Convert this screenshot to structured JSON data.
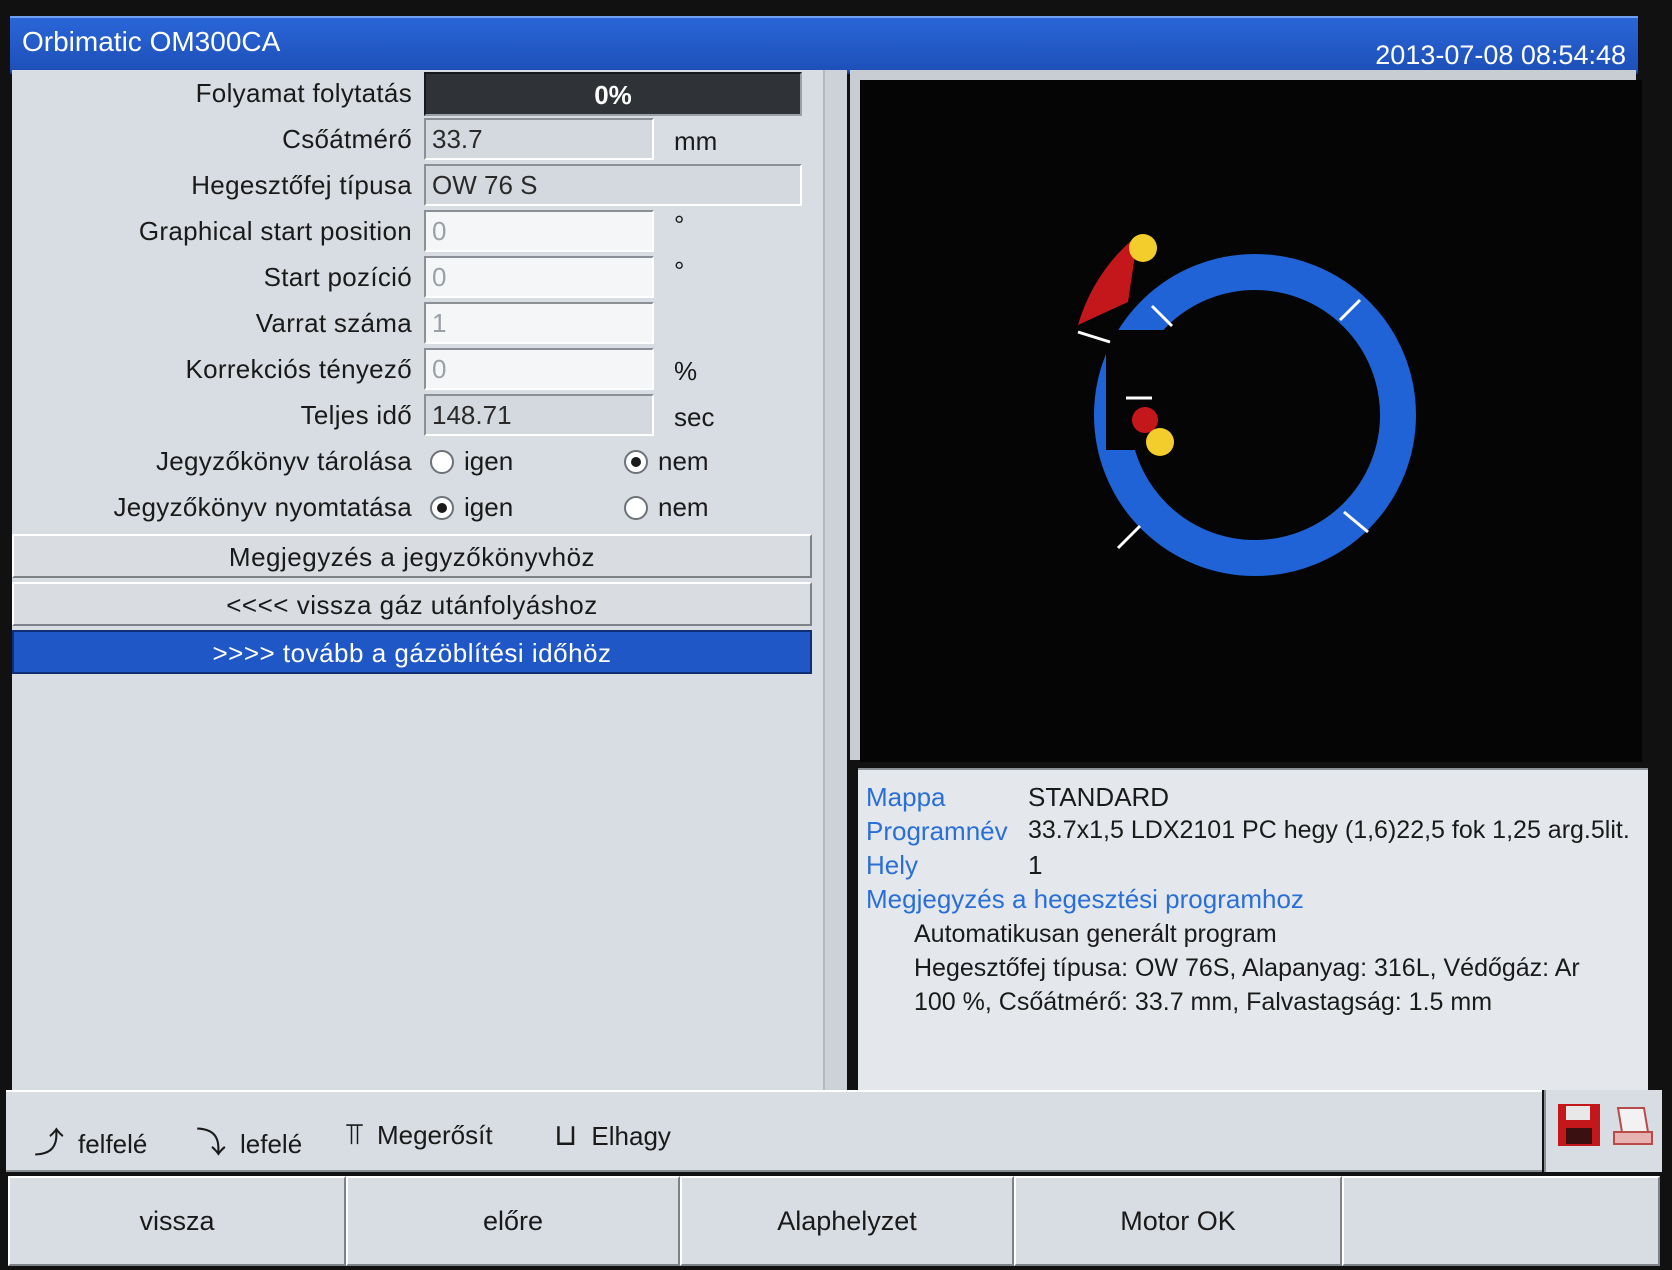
{
  "window": {
    "title": "Orbimatic OM300CA",
    "datetime": "2013-07-08 08:54:48"
  },
  "form": {
    "progress": {
      "label": "Folyamat folytatás",
      "value": "0%"
    },
    "tube_diameter": {
      "label": "Csőátmérő",
      "value": "33.7",
      "unit": "mm"
    },
    "head_type": {
      "label": "Hegesztőfej típusa",
      "value": "OW 76 S"
    },
    "graphical_start": {
      "label": "Graphical start position",
      "value": "0",
      "unit": "°"
    },
    "start_position": {
      "label": "Start pozíció",
      "value": "0",
      "unit": "°"
    },
    "seam_number": {
      "label": "Varrat száma",
      "value": "1"
    },
    "correction": {
      "label": "Korrekciós tényező",
      "value": "0",
      "unit": "%"
    },
    "total_time": {
      "label": "Teljes idő",
      "value": "148.71",
      "unit": "sec"
    },
    "store_protocol": {
      "label": "Jegyzőkönyv tárolása",
      "yes": "igen",
      "no": "nem",
      "selected": "nem"
    },
    "print_protocol": {
      "label": "Jegyzőkönyv nyomtatása",
      "yes": "igen",
      "no": "nem",
      "selected": "igen"
    }
  },
  "buttons": {
    "note": "Megjegyzés a jegyzőkönyvhöz",
    "back": "<<<< vissza gáz utánfolyáshoz",
    "next": ">>>> tovább a gázöblítési időhöz"
  },
  "info": {
    "folder_label": "Mappa",
    "folder_value": "STANDARD",
    "program_label": "Programnév",
    "program_value": "33.7x1,5 LDX2101 PC hegy (1,6)22,5 fok 1,25 arg.5lit.",
    "place_label": "Hely",
    "place_value": "1",
    "note_label": "Megjegyzés a hegesztési programhoz",
    "note_lines": [
      "Automatikusan generált program",
      "Hegesztőfej típusa: OW 76S, Alapanyag: 316L, Védőgáz: Ar",
      "100 %, Csőátmérő:  33.7 mm, Falvastagság:   1.5 mm"
    ]
  },
  "hints": {
    "up": "felfelé",
    "down": "lefelé",
    "confirm": "Megerősít",
    "leave": "Elhagy"
  },
  "icons": [
    "save-icon",
    "print-icon"
  ],
  "function_keys": [
    "vissza",
    "előre",
    "Alaphelyzet",
    "Motor OK",
    ""
  ],
  "colors": {
    "ring": "#1f63d6",
    "marker_yellow": "#f2cd2b",
    "marker_red": "#c4171b",
    "title_bar": "#2a66d8"
  }
}
